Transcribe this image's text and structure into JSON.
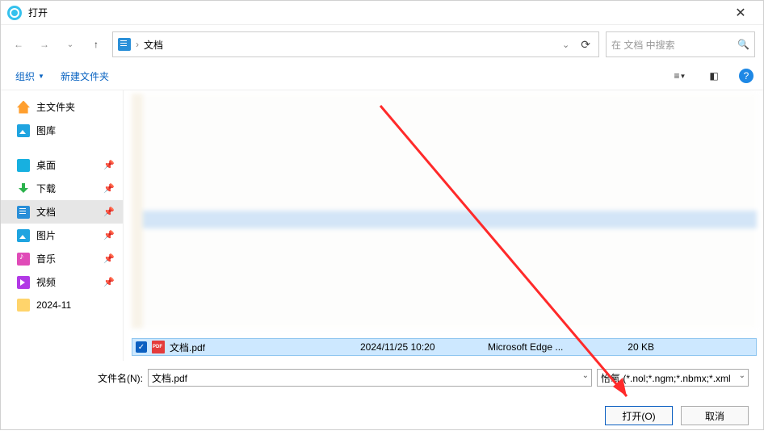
{
  "title": "打开",
  "breadcrumb": {
    "current": "文档"
  },
  "search": {
    "placeholder": "在 文档 中搜索"
  },
  "toolbar": {
    "organize": "组织",
    "newfolder": "新建文件夹"
  },
  "sidebar": {
    "home": "主文件夹",
    "gallery": "图库",
    "desktop": "桌面",
    "downloads": "下载",
    "documents": "文档",
    "pictures": "图片",
    "music": "音乐",
    "videos": "视频",
    "folder_date": "2024-11"
  },
  "file": {
    "name": "文档.pdf",
    "date": "2024/11/25 10:20",
    "type": "Microsoft Edge ...",
    "size": "20 KB"
  },
  "footer": {
    "fn_label": "文件名(N):",
    "fn_value": "文档.pdf",
    "filter": "怡氧 (*.nol;*.ngm;*.nbmx;*.xml",
    "open": "打开(O)",
    "cancel": "取消"
  }
}
